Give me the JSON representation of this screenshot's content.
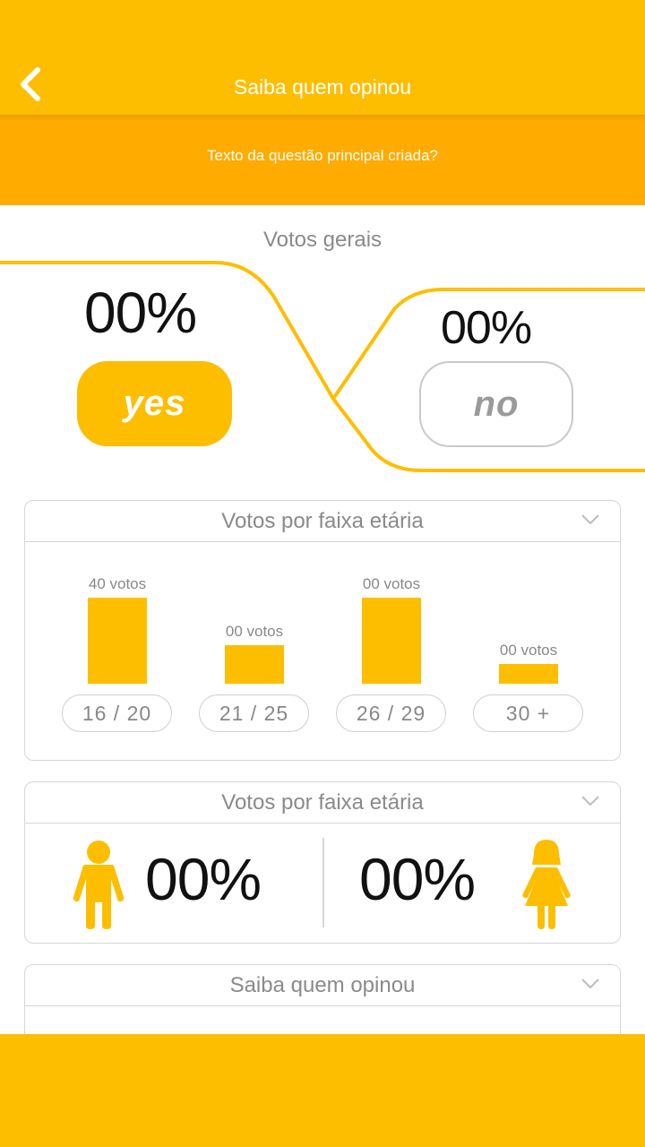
{
  "colors": {
    "accent": "#FDBE00",
    "accent_dark": "#FFAB00",
    "muted": "#8a8a8a"
  },
  "header": {
    "title": "Saiba quem opinou",
    "back_icon": "chevron-left-icon"
  },
  "question": {
    "text": "Texto da questão principal criada?"
  },
  "overall": {
    "label": "Votos gerais",
    "yes_percent": "00%",
    "no_percent": "00%",
    "yes_label": "yes",
    "no_label": "no"
  },
  "age_card": {
    "title": "Votos por faixa etária",
    "chevron_icon": "chevron-down-icon"
  },
  "chart_data": {
    "type": "bar",
    "categories": [
      "16 / 20",
      "21 / 25",
      "26 / 29",
      "30 +"
    ],
    "data_labels": [
      "40 votos",
      "00 votos",
      "00 votos",
      "00 votos"
    ],
    "values": [
      40,
      18,
      40,
      9
    ],
    "ylim": [
      0,
      40
    ]
  },
  "gender_card": {
    "title": "Votos por faixa etária",
    "male_percent": "00%",
    "female_percent": "00%",
    "male_icon": "male-person-icon",
    "female_icon": "female-person-icon"
  },
  "who_card": {
    "title": "Saiba quem opinou"
  }
}
